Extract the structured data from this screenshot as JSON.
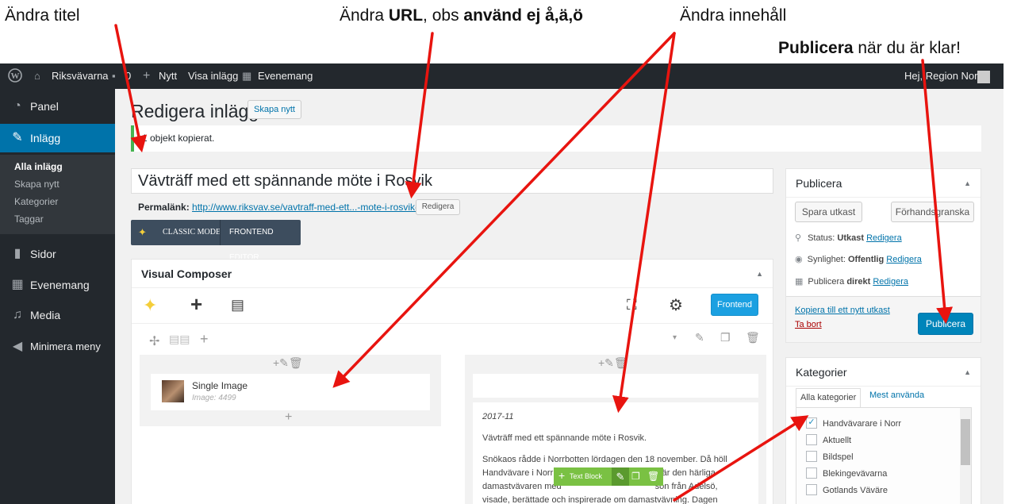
{
  "annotations": {
    "title": "Ändra titel",
    "url_pre": "Ändra ",
    "url_bold": "URL",
    "url_mid": ", obs ",
    "url_bold2": "använd ej å,ä,ö",
    "content": "Ändra innehåll",
    "publish_bold": "Publicera",
    "publish_rest": " när du är klar!"
  },
  "adminbar": {
    "site": "Riksvävarna",
    "comments": "0",
    "new": "Nytt",
    "view": "Visa inlägg",
    "events": "Evenemang",
    "greeting": "Hej, Region Norr"
  },
  "sidebar": {
    "panel": "Panel",
    "posts": "Inlägg",
    "sub": [
      "Alla inlägg",
      "Skapa nytt",
      "Kategorier",
      "Taggar"
    ],
    "pages": "Sidor",
    "events": "Evenemang",
    "media": "Media",
    "collapse": "Minimera meny"
  },
  "page": {
    "title": "Redigera inlägg",
    "add_new": "Skapa nytt",
    "notice": "1 objekt kopierat.",
    "post_title": "Vävträff med ett spännande möte i Rosvik",
    "permalink_label": "Permalänk:",
    "permalink_url": "http://www.riksvav.se/vavtraff-med-ett...-mote-i-rosvik-2/",
    "permalink_edit": "Redigera",
    "classic_mode": "CLASSIC MODE",
    "frontend_editor": "FRONTEND EDITOR"
  },
  "composer": {
    "title": "Visual Composer",
    "frontend": "Frontend",
    "single_image": "Single Image",
    "image_id": "Image: 4499",
    "text_date": "2017-11",
    "text_heading": "Vävträff med ett spännande möte i Rosvik.",
    "text_body_1": "Snökaos rådde i Norrbotten lördagen den 18 november. Då höll",
    "text_body_2": "Handvävare i Norr en trevlig vävträff i Rosvik där den härliga",
    "text_body_3": "damastvävaren med",
    "text_body_3b": "son från Adelsö,",
    "text_body_4": "visade, berättade och inspirerade om damastvävning. Dagen",
    "text_block_label": "Text Block"
  },
  "publish_box": {
    "title": "Publicera",
    "save_draft": "Spara utkast",
    "preview": "Förhandsgranska",
    "status_label": "Status:",
    "status_value": "Utkast",
    "visibility_label": "Synlighet:",
    "visibility_value": "Offentlig",
    "publish_label": "Publicera",
    "publish_value": "direkt",
    "edit": "Redigera",
    "copy_draft": "Kopiera till ett nytt utkast",
    "trash": "Ta bort",
    "publish_button": "Publicera"
  },
  "categories_box": {
    "title": "Kategorier",
    "tab_all": "Alla kategorier",
    "tab_popular": "Mest använda",
    "items": [
      "Handvävarare i Norr",
      "Aktuellt",
      "Bildspel",
      "Blekingevävarna",
      "Gotlands Väväre"
    ],
    "checked": [
      true,
      false,
      false,
      false,
      false
    ]
  },
  "colors": {
    "adminbar": "#23282d",
    "active": "#0073aa",
    "arrow": "#e8140f",
    "vc_green": "#7ac143",
    "primary": "#0085ba"
  }
}
